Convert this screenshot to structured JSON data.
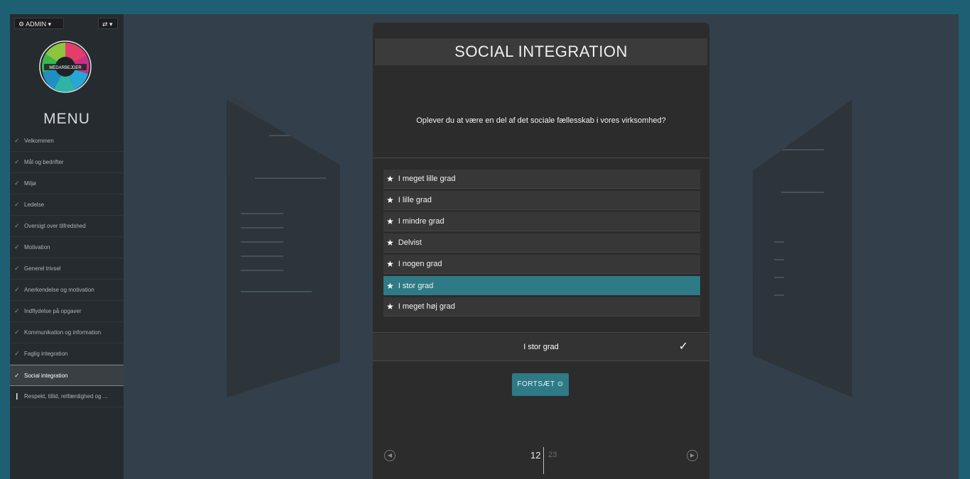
{
  "sidebar": {
    "admin_label": "ADMIN ▾",
    "switch_label": "⇄ ▾",
    "logo_text": "MEDARBEJDER",
    "menu_title": "MENU",
    "items": [
      {
        "label": "Velkommen",
        "check": "✓"
      },
      {
        "label": "Mål og bedrifter",
        "check": "✓"
      },
      {
        "label": "Miljø",
        "check": "✓"
      },
      {
        "label": "Ledelse",
        "check": "✓"
      },
      {
        "label": "Oversigt over tilfredshed",
        "check": "✓"
      },
      {
        "label": "Motivation",
        "check": "✓"
      },
      {
        "label": "Generel trivsel",
        "check": "✓"
      },
      {
        "label": "Anerkendelse og motivation",
        "check": "✓"
      },
      {
        "label": "Indflydelse på opgaver",
        "check": "✓"
      },
      {
        "label": "Kommunikation og information",
        "check": "✓"
      },
      {
        "label": "Faglig integration",
        "check": "✓"
      },
      {
        "label": "Social integration",
        "check": "✓"
      },
      {
        "label": "Respekt, tillid, retfærdighed og ...",
        "check": "❙"
      }
    ]
  },
  "card": {
    "title": "SOCIAL INTEGRATION",
    "question": "Oplever du at være en del af det sociale fællesskab i vores virksomhed?",
    "options": [
      "I meget lille grad",
      "I lille grad",
      "I mindre grad",
      "Delvist",
      "I nogen grad",
      "I stor grad",
      "I meget høj grad"
    ],
    "selected_answer": "I stor grad",
    "answer_check": "✓",
    "continue_label": "FORTSÆT ⊙",
    "prev_icon": "◀",
    "next_icon": "▶",
    "page_current": "12",
    "page_total": "23"
  },
  "colors": {
    "accent": "#2e7a86",
    "background": "#33404b",
    "sidebar": "#262b2f",
    "card": "#2c2c2c"
  }
}
